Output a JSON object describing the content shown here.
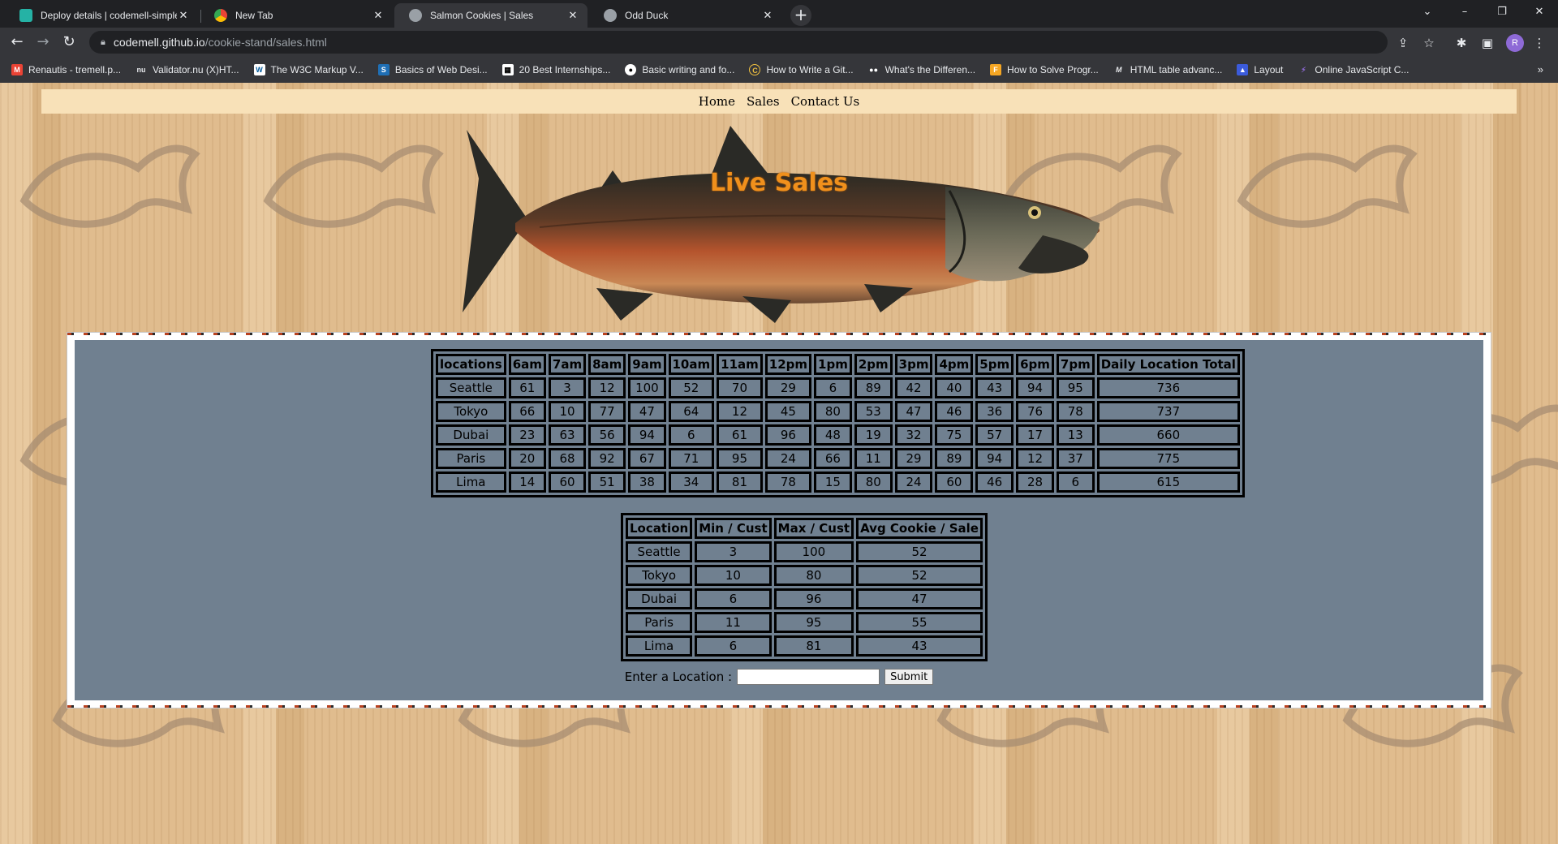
{
  "browser": {
    "tabs": [
      {
        "label": "Deploy details | codemell-simple",
        "active": false
      },
      {
        "label": "New Tab",
        "active": false
      },
      {
        "label": "Salmon Cookies | Sales",
        "active": true
      },
      {
        "label": "Odd Duck",
        "active": false
      }
    ],
    "url_host": "codemell.github.io",
    "url_path": "/cookie-stand/sales.html",
    "profile_initial": "R",
    "bookmarks": [
      "Renautis - tremell.p...",
      "Validator.nu (X)HT...",
      "The W3C Markup V...",
      "Basics of Web Desi...",
      "20 Best Internships...",
      "Basic writing and fo...",
      "How to Write a Git...",
      "What's the Differen...",
      "How to Solve Progr...",
      "HTML table advanc...",
      "Layout",
      "Online JavaScript C..."
    ]
  },
  "nav": {
    "home": "Home",
    "sales": "Sales",
    "contact": "Contact Us"
  },
  "hero": {
    "title": "Live Sales"
  },
  "sales_table": {
    "headers": [
      "locations",
      "6am",
      "7am",
      "8am",
      "9am",
      "10am",
      "11am",
      "12pm",
      "1pm",
      "2pm",
      "3pm",
      "4pm",
      "5pm",
      "6pm",
      "7pm",
      "Daily Location Total"
    ],
    "rows": [
      [
        "Seattle",
        "61",
        "3",
        "12",
        "100",
        "52",
        "70",
        "29",
        "6",
        "89",
        "42",
        "40",
        "43",
        "94",
        "95",
        "736"
      ],
      [
        "Tokyo",
        "66",
        "10",
        "77",
        "47",
        "64",
        "12",
        "45",
        "80",
        "53",
        "47",
        "46",
        "36",
        "76",
        "78",
        "737"
      ],
      [
        "Dubai",
        "23",
        "63",
        "56",
        "94",
        "6",
        "61",
        "96",
        "48",
        "19",
        "32",
        "75",
        "57",
        "17",
        "13",
        "660"
      ],
      [
        "Paris",
        "20",
        "68",
        "92",
        "67",
        "71",
        "95",
        "24",
        "66",
        "11",
        "29",
        "89",
        "94",
        "12",
        "37",
        "775"
      ],
      [
        "Lima",
        "14",
        "60",
        "51",
        "38",
        "34",
        "81",
        "78",
        "15",
        "80",
        "24",
        "60",
        "46",
        "28",
        "6",
        "615"
      ]
    ]
  },
  "stats_table": {
    "headers": [
      "Location",
      "Min / Cust",
      "Max / Cust",
      "Avg Cookie / Sale"
    ],
    "rows": [
      [
        "Seattle",
        "3",
        "100",
        "52"
      ],
      [
        "Tokyo",
        "10",
        "80",
        "52"
      ],
      [
        "Dubai",
        "6",
        "96",
        "47"
      ],
      [
        "Paris",
        "11",
        "95",
        "55"
      ],
      [
        "Lima",
        "6",
        "81",
        "43"
      ]
    ]
  },
  "form": {
    "label": "Enter a Location :",
    "placeholder": "",
    "submit_label": "Submit"
  },
  "colors": {
    "panel": "#708090",
    "navbar": "#f8e1b8",
    "title": "#f0901c"
  }
}
